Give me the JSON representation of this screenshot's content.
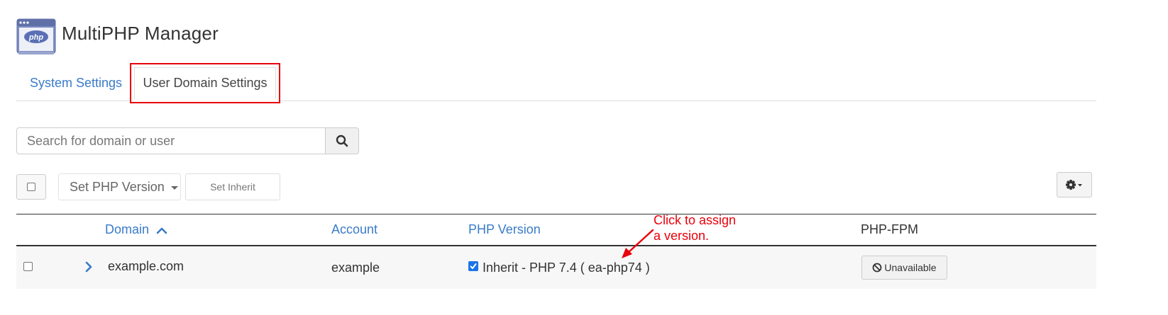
{
  "header": {
    "icon_label": "php",
    "title": "MultiPHP Manager"
  },
  "tabs": [
    {
      "label": "System Settings",
      "active": false
    },
    {
      "label": "User Domain Settings",
      "active": true
    }
  ],
  "search": {
    "placeholder": "Search for domain or user",
    "value": ""
  },
  "toolbar": {
    "select_all_checked": false,
    "set_php_version_label": "Set PHP Version",
    "set_inherit_label": "Set Inherit",
    "settings_icon": "gear-icon"
  },
  "table": {
    "columns": [
      "Domain",
      "Account",
      "PHP Version",
      "PHP-FPM"
    ],
    "sort": {
      "column": "Domain",
      "direction": "ascending"
    },
    "rows": [
      {
        "checked": false,
        "domain": "example.com",
        "account": "example",
        "php_inherit_checked": true,
        "php_version": "Inherit - PHP 7.4 ( ea-php74 )",
        "php_fpm": "Unavailable"
      }
    ]
  },
  "annotation": {
    "line1": "Click to assign",
    "line2": "a version.",
    "color": "#e8000b"
  },
  "colors": {
    "link": "#3a7bc8",
    "highlight_border": "#e8000b",
    "checkbox_checked": "#1a73e8"
  }
}
